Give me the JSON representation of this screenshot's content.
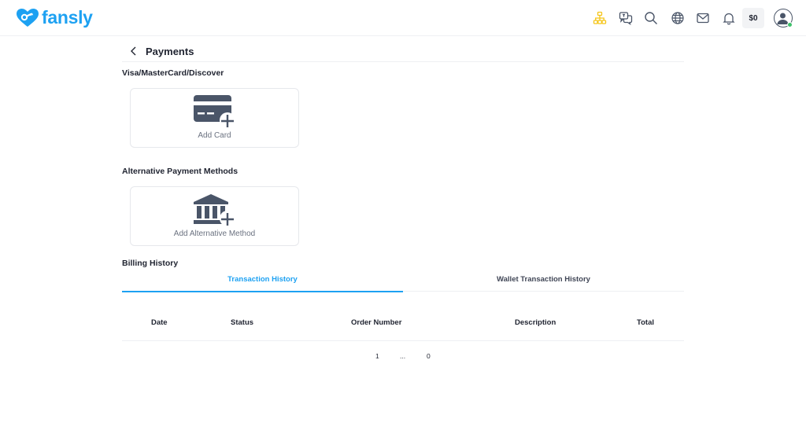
{
  "brand": {
    "name": "fansly",
    "color": "#1da1f2"
  },
  "topbar": {
    "icons": [
      "network-icon",
      "chat-icon",
      "search-icon",
      "globe-icon",
      "mail-icon",
      "bell-icon"
    ],
    "balance": "$0"
  },
  "page": {
    "title": "Payments"
  },
  "sections": {
    "cards": {
      "title": "Visa/MasterCard/Discover",
      "add_label": "Add Card"
    },
    "alternative": {
      "title": "Alternative Payment Methods",
      "add_label": "Add Alternative Method"
    },
    "billing": {
      "title": "Billing History"
    }
  },
  "tabs": [
    {
      "label": "Transaction History",
      "active": true
    },
    {
      "label": "Wallet Transaction History",
      "active": false
    }
  ],
  "table": {
    "columns": [
      "Date",
      "Status",
      "Order Number",
      "Description",
      "Total"
    ],
    "rows": []
  },
  "pagination": {
    "first": "1",
    "ellipsis": "...",
    "last": "0"
  },
  "colors": {
    "accent": "#1da1f2",
    "online": "#3ec16a",
    "highlight_icon": "#f5c518"
  }
}
